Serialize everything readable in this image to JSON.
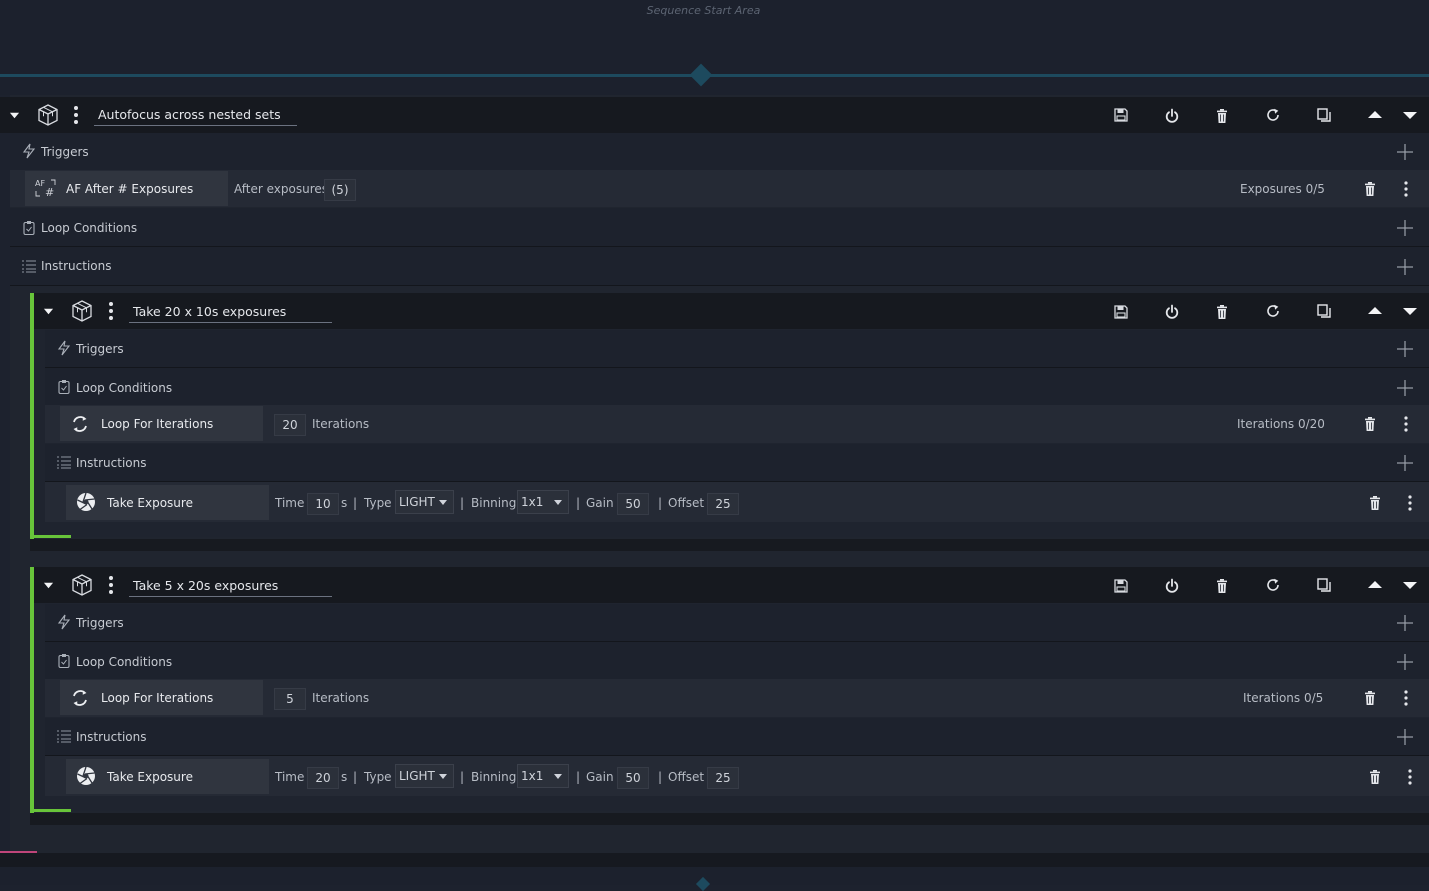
{
  "start_area": {
    "label": "Sequence Start Area"
  },
  "outer": {
    "title": "Autofocus across nested sets",
    "triggers_label": "Triggers",
    "trigger": {
      "name": "AF After # Exposures",
      "param_label": "After exposures",
      "param_value": "(5)",
      "status": "Exposures 0/5"
    },
    "loop_label": "Loop Conditions",
    "instructions_label": "Instructions"
  },
  "sets": [
    {
      "title": "Take 20 x 10s exposures",
      "triggers_label": "Triggers",
      "loop_label": "Loop Conditions",
      "loop": {
        "name": "Loop For Iterations",
        "value": "20",
        "unit": "Iterations",
        "status": "Iterations 0/20"
      },
      "instructions_label": "Instructions",
      "exposure": {
        "name": "Take Exposure",
        "time_label": "Time",
        "time": "10",
        "time_unit": "s",
        "type_label": "Type",
        "type": "LIGHT",
        "binning_label": "Binning",
        "binning": "1x1",
        "gain_label": "Gain",
        "gain": "50",
        "offset_label": "Offset",
        "offset": "25"
      }
    },
    {
      "title": "Take 5 x 20s exposures",
      "triggers_label": "Triggers",
      "loop_label": "Loop Conditions",
      "loop": {
        "name": "Loop For Iterations",
        "value": "5",
        "unit": "Iterations",
        "status": "Iterations 0/5"
      },
      "instructions_label": "Instructions",
      "exposure": {
        "name": "Take Exposure",
        "time_label": "Time",
        "time": "20",
        "time_unit": "s",
        "type_label": "Type",
        "type": "LIGHT",
        "binning_label": "Binning",
        "binning": "1x1",
        "gain_label": "Gain",
        "gain": "50",
        "offset_label": "Offset",
        "offset": "25"
      }
    }
  ],
  "separator": "|",
  "icons": [
    "collapse-icon",
    "container-icon",
    "kebab-menu-icon",
    "save-icon",
    "power-icon",
    "trash-icon",
    "reset-icon",
    "duplicate-icon",
    "move-up-icon",
    "move-down-icon",
    "plus-icon",
    "trigger-icon",
    "loop-conditions-icon",
    "instructions-icon",
    "af-icon",
    "loop-icon",
    "aperture-icon"
  ],
  "colors": {
    "accent_green": "#68c43a",
    "drop_line": "#1d4a5e",
    "bottom_accent": "#c0457a"
  }
}
